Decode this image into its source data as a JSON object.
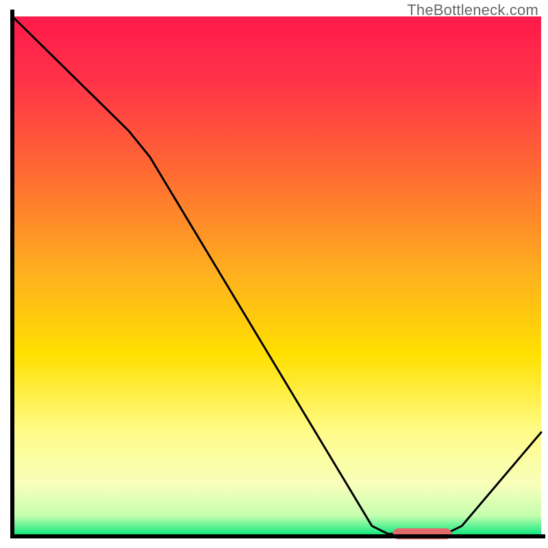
{
  "watermark": "TheBottleneck.com",
  "chart_data": {
    "type": "line",
    "title": "",
    "xlabel": "",
    "ylabel": "",
    "xlim": [
      0,
      100
    ],
    "ylim": [
      0,
      100
    ],
    "gradient_stops": [
      {
        "offset": 0.0,
        "color": "#ff1a4a"
      },
      {
        "offset": 0.12,
        "color": "#ff3249"
      },
      {
        "offset": 0.3,
        "color": "#ff6a32"
      },
      {
        "offset": 0.5,
        "color": "#ffb21e"
      },
      {
        "offset": 0.65,
        "color": "#ffe000"
      },
      {
        "offset": 0.8,
        "color": "#fffc8a"
      },
      {
        "offset": 0.9,
        "color": "#f7ffba"
      },
      {
        "offset": 0.96,
        "color": "#c6ffb0"
      },
      {
        "offset": 1.0,
        "color": "#00e67a"
      }
    ],
    "series": [
      {
        "name": "bottleneck-curve",
        "points": [
          {
            "x": 0,
            "y": 100
          },
          {
            "x": 22,
            "y": 78
          },
          {
            "x": 26,
            "y": 73
          },
          {
            "x": 68,
            "y": 2
          },
          {
            "x": 71,
            "y": 0.5
          },
          {
            "x": 82,
            "y": 0.5
          },
          {
            "x": 85,
            "y": 2
          },
          {
            "x": 100,
            "y": 20
          }
        ]
      }
    ],
    "marker": {
      "x_start": 73,
      "x_end": 82,
      "y": 0.5,
      "color": "#e26a6a"
    },
    "axis_color": "#000000",
    "axis_width": 6
  }
}
